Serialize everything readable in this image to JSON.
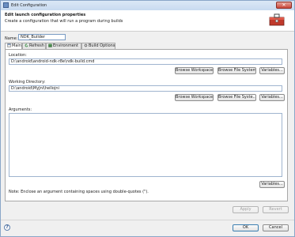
{
  "window": {
    "title": "Edit Configuration",
    "close_glyph": "✕"
  },
  "header": {
    "title": "Edit launch configuration properties",
    "subtitle": "Create a configuration that will run a program during builds"
  },
  "name": {
    "label": "Name:",
    "value": "NDK_Builder"
  },
  "tabs": [
    {
      "label": "Main",
      "icon": "main-tab-icon",
      "active": true
    },
    {
      "label": "Refresh",
      "icon": "refresh-icon",
      "active": false
    },
    {
      "label": "Environment",
      "icon": "environment-icon",
      "active": false
    },
    {
      "label": "Build Options",
      "icon": "build-options-icon",
      "active": false
    }
  ],
  "main": {
    "location": {
      "label": "Location:",
      "value": "D:\\android\\android-ndk-r8e\\ndk-build.cmd",
      "buttons": [
        "Browse Workspace...",
        "Browse File System...",
        "Variables..."
      ]
    },
    "working_directory": {
      "label": "Working Directory:",
      "value": "D:\\android\\MyJni\\hellojni",
      "buttons": [
        "Browse Workspace...",
        "Browse File Syste...",
        "Variables..."
      ]
    },
    "arguments": {
      "label": "Arguments:",
      "value": "",
      "variables_button": "Variables..."
    },
    "note": "Note: Enclose an argument containing spaces using double-quotes (\")."
  },
  "panel_buttons": {
    "apply": "Apply",
    "revert": "Revert"
  },
  "footer": {
    "help_glyph": "?",
    "ok": "OK",
    "cancel": "Cancel"
  },
  "colors": {
    "accent": "#7a9cc4",
    "title_bar": "#c8daf0",
    "close": "#c9463a"
  }
}
